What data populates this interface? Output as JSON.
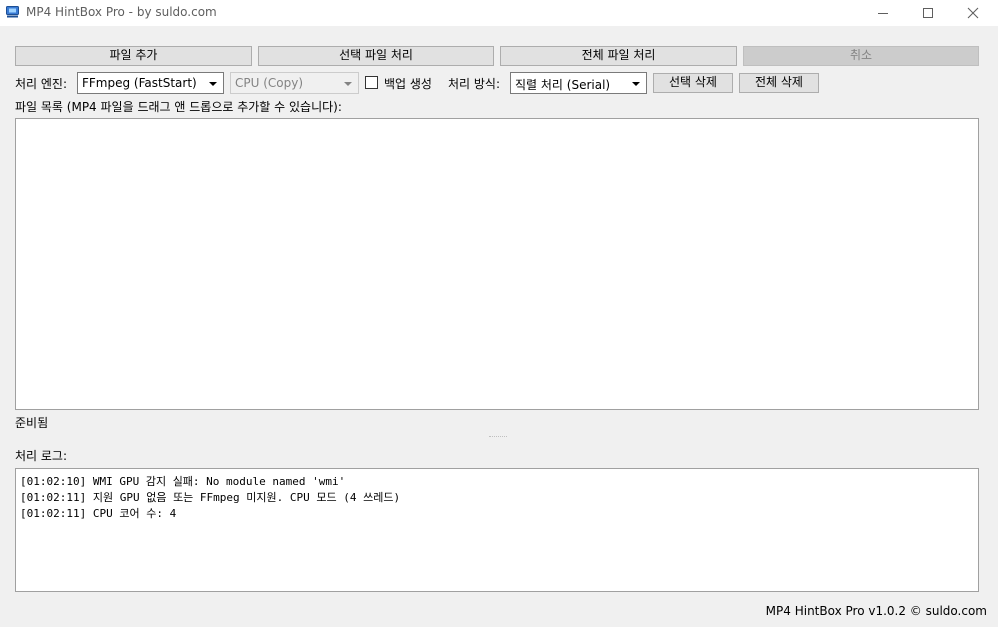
{
  "window": {
    "title": "MP4 HintBox Pro - by suldo.com",
    "controls": [
      "minimize-icon",
      "maximize-icon",
      "close-icon"
    ]
  },
  "toolbar": {
    "add_files": "파일 추가",
    "process_selected": "선택 파일 처리",
    "process_all": "전체 파일 처리",
    "cancel": "취소"
  },
  "options": {
    "engine_label": "처리 엔진:",
    "engine_value": "FFmpeg (FastStart)",
    "device_value": "CPU (Copy)",
    "backup_label": "백업 생성",
    "backup_checked": false,
    "mode_label": "처리 방식:",
    "mode_value": "직렬 처리 (Serial)",
    "delete_selected": "선택 삭제",
    "delete_all": "전체 삭제"
  },
  "file_list": {
    "label": "파일 목록 (MP4 파일을 드래그 앤 드롭으로 추가할 수 있습니다):",
    "items": []
  },
  "status": "준비됨",
  "log": {
    "label": "처리 로그:",
    "lines": [
      "[01:02:10] WMI GPU 감지 실패: No module named 'wmi'",
      "[01:02:11] 지원 GPU 없음 또는 FFmpeg 미지원. CPU 모드 (4 쓰레드)",
      "[01:02:11] CPU 코어 수: 4"
    ]
  },
  "footer": "MP4 HintBox Pro v1.0.2 © suldo.com",
  "colors": {
    "window_bg": "#f0f0f0",
    "titlebar_bg": "#ffffff",
    "button_bg": "#e1e1e1",
    "button_border": "#adadad",
    "disabled_text": "#838383"
  }
}
